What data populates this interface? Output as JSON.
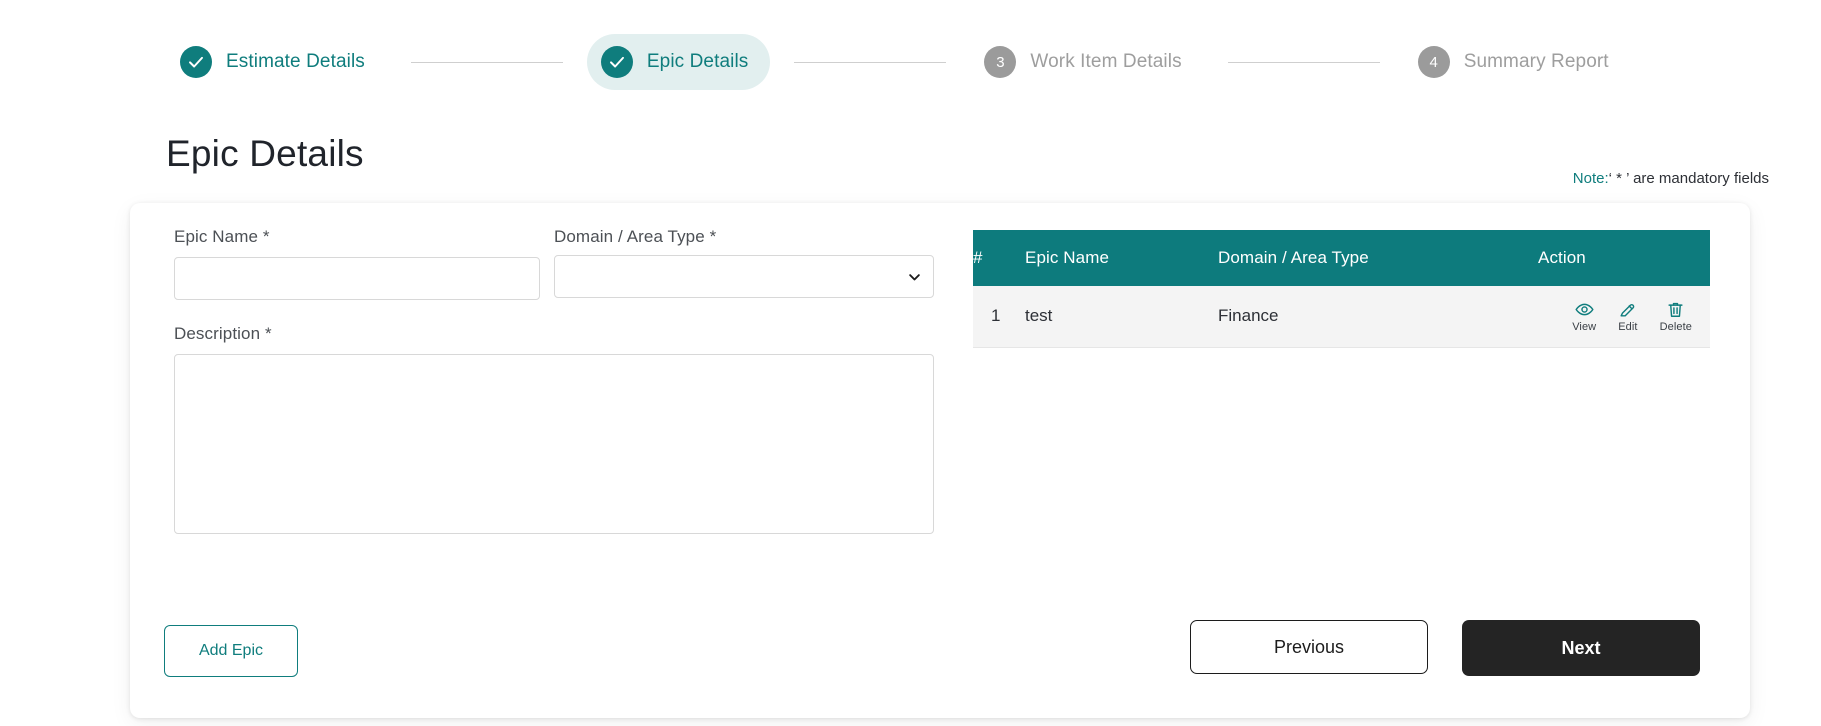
{
  "stepper": {
    "steps": [
      {
        "label": "Estimate Details",
        "state": "done",
        "badge": "check"
      },
      {
        "label": "Epic Details",
        "state": "active",
        "badge": "check"
      },
      {
        "label": "Work Item Details",
        "state": "todo",
        "badge": "3"
      },
      {
        "label": "Summary Report",
        "state": "todo",
        "badge": "4"
      }
    ]
  },
  "header": {
    "title": "Epic Details",
    "note_lead": "Note:",
    "note_text": "‘ * ’ are mandatory fields"
  },
  "form": {
    "epic_name": {
      "label": "Epic Name *",
      "value": "",
      "placeholder": ""
    },
    "domain": {
      "label": "Domain / Area Type *",
      "value": "",
      "placeholder": "",
      "options": [
        "",
        "Finance"
      ]
    },
    "description": {
      "label": "Description *",
      "value": "",
      "placeholder": ""
    },
    "add_epic_label": "Add Epic"
  },
  "table": {
    "columns": {
      "num": "#",
      "name": "Epic Name",
      "domain": "Domain / Area Type",
      "action": "Action"
    },
    "rows": [
      {
        "num": "1",
        "name": "test",
        "domain": "Finance",
        "actions": {
          "view": "View",
          "edit": "Edit",
          "delete": "Delete"
        }
      }
    ]
  },
  "footer": {
    "previous_label": "Previous",
    "next_label": "Next"
  },
  "colors": {
    "teal": "#0f7d7d",
    "teal_header": "#0d7b7d",
    "active_pill": "#e2efef",
    "muted_grey": "#9e9e9e",
    "badge_grey": "#9b9b9b",
    "row_bg": "#f4f4f4",
    "dark_button": "#242424"
  }
}
